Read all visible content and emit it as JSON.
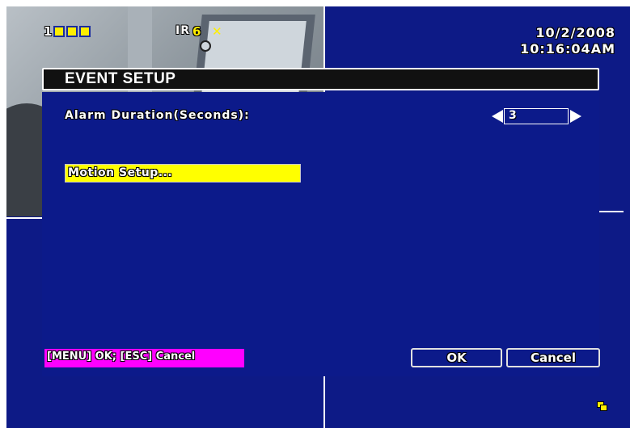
{
  "osd": {
    "channel": "1",
    "ir_label": "IR",
    "ir_value": "6",
    "date": "10/2/2008",
    "time": "10:16:04AM"
  },
  "dialog": {
    "title": "EVENT SETUP",
    "alarm_duration_label": "Alarm Duration(Seconds):",
    "alarm_duration_value": "3",
    "motion_setup_label": "Motion Setup...",
    "hint": "[MENU] OK; [ESC] Cancel",
    "ok_label": "OK",
    "cancel_label": "Cancel"
  },
  "colors": {
    "background": "#0d1a86",
    "highlight": "#ffff00",
    "hint_bar": "#ff00ff",
    "title_bar": "#111111"
  },
  "icons": [
    "channel-status-icons",
    "mute-icon",
    "clock-icon",
    "arrow-left-icon",
    "arrow-right-icon",
    "network-icon"
  ]
}
